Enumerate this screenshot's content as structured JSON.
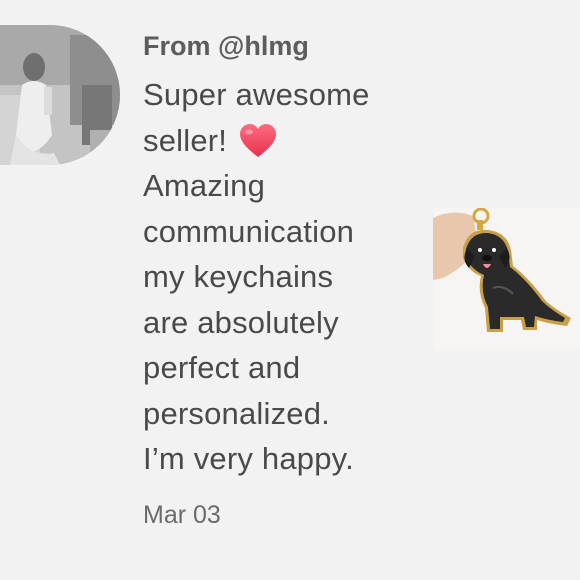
{
  "review": {
    "from_label": "From @hlmg",
    "lines": [
      "Super awesome",
      "seller!",
      "Amazing",
      "communication",
      "my keychains",
      "are absolutely",
      "perfect and",
      "personalized.",
      "I’m very happy."
    ],
    "date": "Mar 03"
  },
  "icons": {
    "heart": "heart-emoji-icon"
  },
  "colors": {
    "background": "#f2f2f2",
    "heart": "#f2455f",
    "text": "#4a4a4a"
  }
}
